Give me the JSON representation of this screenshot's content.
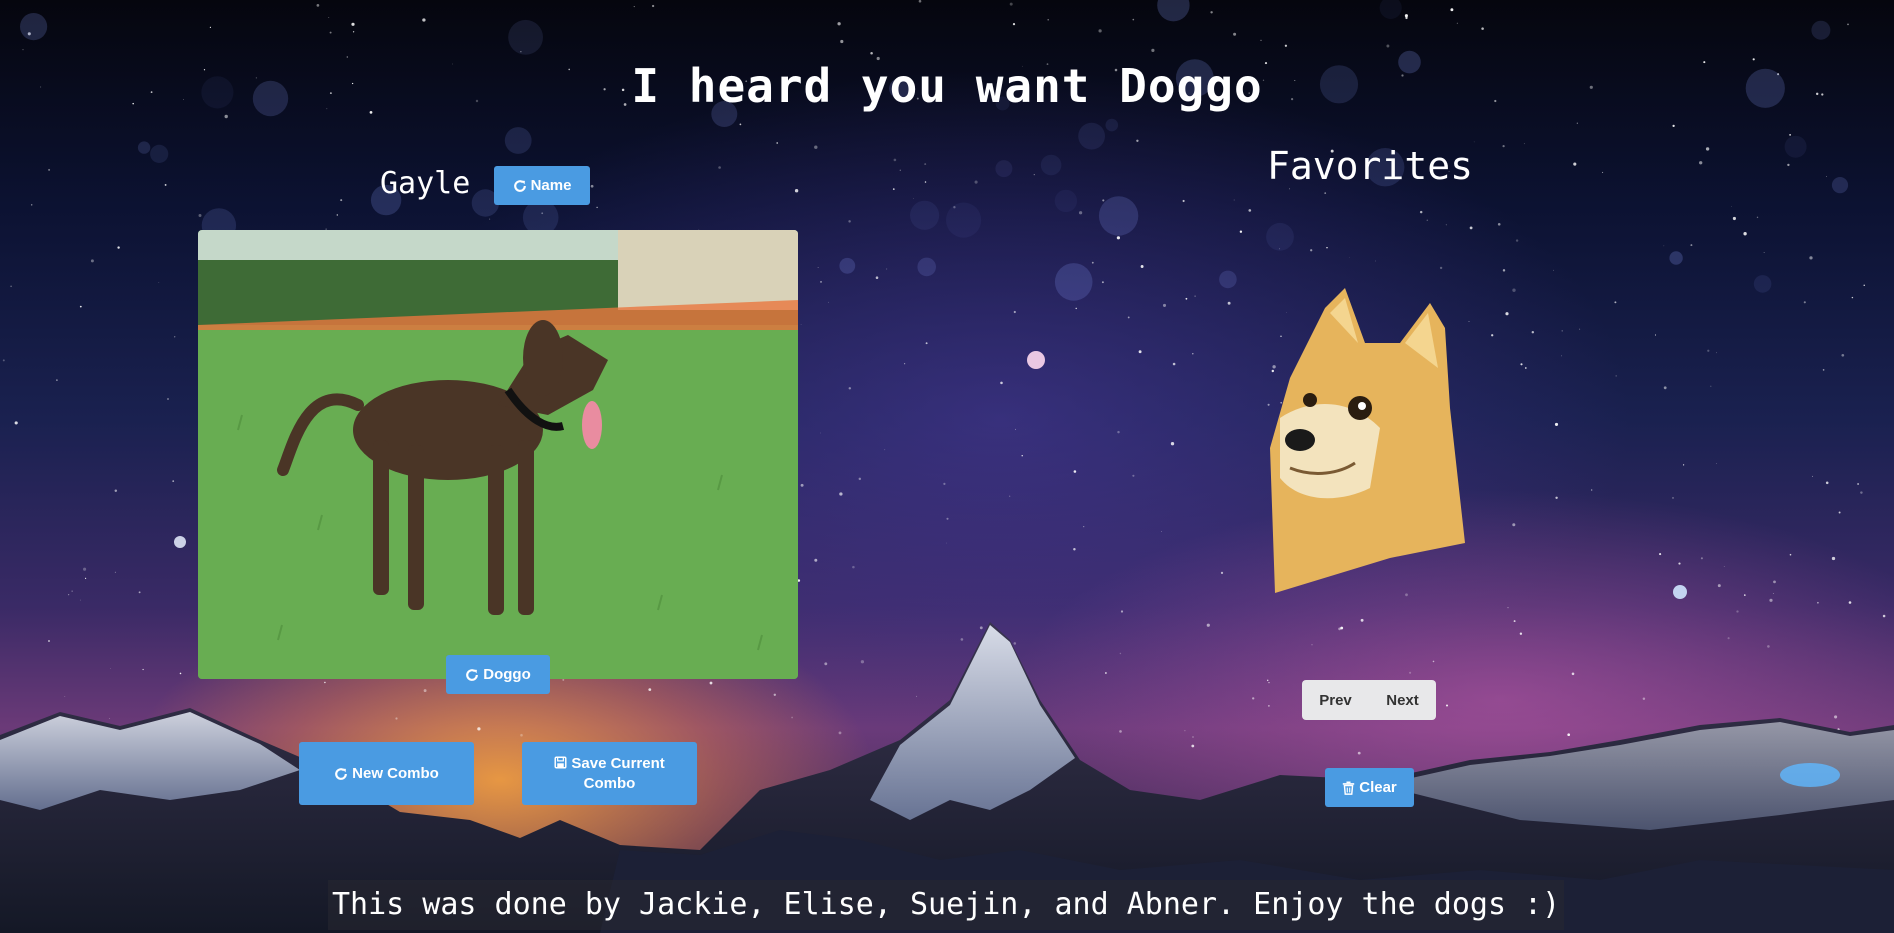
{
  "page": {
    "title": "I heard you want Doggo"
  },
  "generator": {
    "dog_name": "Gayle",
    "name_button": "Name",
    "doggo_button": "Doggo",
    "new_combo_button": "New Combo",
    "save_combo_button": "Save Current Combo",
    "photo_alt": "brindle dog on grass"
  },
  "favorites": {
    "title": "Favorites",
    "image_alt": "doge shiba inu",
    "prev_button": "Prev",
    "next_button": "Next",
    "clear_button": "Clear"
  },
  "footer": {
    "credit": "This was done by Jackie, Elise, Suejin, and Abner. Enjoy the dogs :)"
  },
  "icons": {
    "refresh": "refresh-icon",
    "save": "floppy-disk-icon",
    "trash": "trash-icon"
  },
  "colors": {
    "button_primary": "#4a9be2",
    "pager_bg": "#e8e8ea"
  }
}
